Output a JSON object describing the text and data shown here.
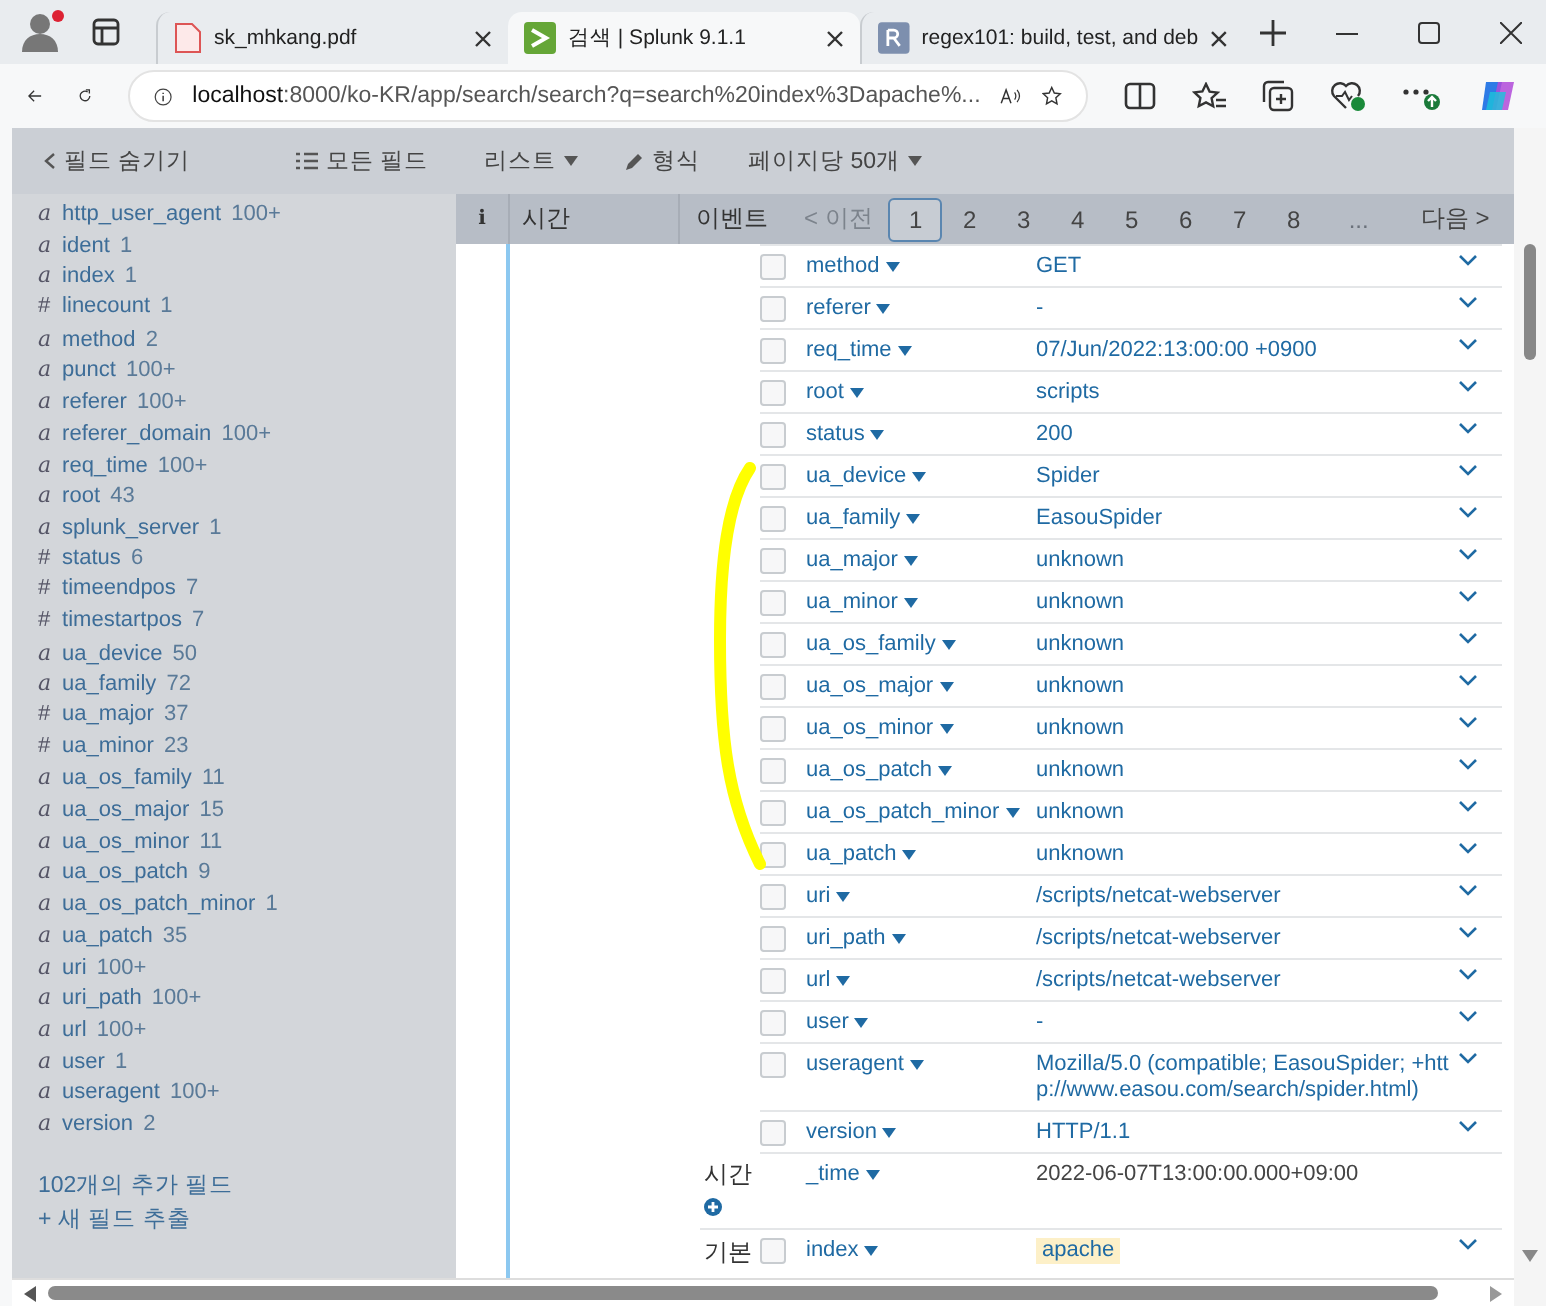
{
  "browser": {
    "tabs": [
      {
        "title": "sk_mhkang.pdf",
        "kind": "pdf",
        "selected": false
      },
      {
        "title": "검색 | Splunk 9.1.1",
        "kind": "splunk",
        "selected": true
      },
      {
        "title": "regex101: build, test, and deb",
        "kind": "regex",
        "selected": false
      }
    ],
    "url_host": "localhost",
    "url_rest": ":8000/ko-KR/app/search/search?q=search%20index%3Dapache%..."
  },
  "toolbar": {
    "hide_fields": "필드 숨기기",
    "all_fields": "모든 필드",
    "list": "리스트",
    "format": "형식",
    "per_page": "페이지당 50개"
  },
  "sidebar": {
    "fields": [
      {
        "icon": "a",
        "name": "http_user_agent",
        "count": "100+"
      },
      {
        "icon": "a",
        "name": "ident",
        "count": "1"
      },
      {
        "icon": "a",
        "name": "index",
        "count": "1"
      },
      {
        "icon": "#",
        "name": "linecount",
        "count": "1"
      },
      {
        "icon": "a",
        "name": "method",
        "count": "2"
      },
      {
        "icon": "a",
        "name": "punct",
        "count": "100+"
      },
      {
        "icon": "a",
        "name": "referer",
        "count": "100+"
      },
      {
        "icon": "a",
        "name": "referer_domain",
        "count": "100+"
      },
      {
        "icon": "a",
        "name": "req_time",
        "count": "100+"
      },
      {
        "icon": "a",
        "name": "root",
        "count": "43"
      },
      {
        "icon": "a",
        "name": "splunk_server",
        "count": "1"
      },
      {
        "icon": "#",
        "name": "status",
        "count": "6"
      },
      {
        "icon": "#",
        "name": "timeendpos",
        "count": "7"
      },
      {
        "icon": "#",
        "name": "timestartpos",
        "count": "7"
      },
      {
        "icon": "a",
        "name": "ua_device",
        "count": "50"
      },
      {
        "icon": "a",
        "name": "ua_family",
        "count": "72"
      },
      {
        "icon": "#",
        "name": "ua_major",
        "count": "37"
      },
      {
        "icon": "#",
        "name": "ua_minor",
        "count": "23"
      },
      {
        "icon": "a",
        "name": "ua_os_family",
        "count": "11"
      },
      {
        "icon": "a",
        "name": "ua_os_major",
        "count": "15"
      },
      {
        "icon": "a",
        "name": "ua_os_minor",
        "count": "11"
      },
      {
        "icon": "a",
        "name": "ua_os_patch",
        "count": "9"
      },
      {
        "icon": "a",
        "name": "ua_os_patch_minor",
        "count": "1"
      },
      {
        "icon": "a",
        "name": "ua_patch",
        "count": "35"
      },
      {
        "icon": "a",
        "name": "uri",
        "count": "100+"
      },
      {
        "icon": "a",
        "name": "uri_path",
        "count": "100+"
      },
      {
        "icon": "a",
        "name": "url",
        "count": "100+"
      },
      {
        "icon": "a",
        "name": "user",
        "count": "1"
      },
      {
        "icon": "a",
        "name": "useragent",
        "count": "100+"
      },
      {
        "icon": "a",
        "name": "version",
        "count": "2"
      }
    ],
    "more_fields": "102개의 추가 필드",
    "extract": "+ 새 필드 추출"
  },
  "table": {
    "columns": [
      "i",
      "시간",
      "이벤트"
    ],
    "pagination": {
      "prev": "< 이전",
      "prev_disabled": true,
      "pages": [
        {
          "label": "1",
          "selected": true
        },
        {
          "label": "2",
          "selected": false
        },
        {
          "label": "3",
          "selected": false
        },
        {
          "label": "4",
          "selected": false
        },
        {
          "label": "5",
          "selected": false
        },
        {
          "label": "6",
          "selected": false
        },
        {
          "label": "7",
          "selected": false
        },
        {
          "label": "8",
          "selected": false
        }
      ],
      "ellipsis": "...",
      "next": "다음 >"
    },
    "fields": [
      {
        "name": "method",
        "value": "GET",
        "checked": false
      },
      {
        "name": "referer",
        "value": "-",
        "checked": false
      },
      {
        "name": "req_time",
        "value": "07/Jun/2022:13:00:00 +0900",
        "checked": false
      },
      {
        "name": "root",
        "value": "scripts",
        "checked": false
      },
      {
        "name": "status",
        "value": "200",
        "checked": false
      },
      {
        "name": "ua_device",
        "value": "Spider",
        "checked": false
      },
      {
        "name": "ua_family",
        "value": "EasouSpider",
        "checked": false
      },
      {
        "name": "ua_major",
        "value": "unknown",
        "checked": false
      },
      {
        "name": "ua_minor",
        "value": "unknown",
        "checked": false
      },
      {
        "name": "ua_os_family",
        "value": "unknown",
        "checked": false
      },
      {
        "name": "ua_os_major",
        "value": "unknown",
        "checked": false
      },
      {
        "name": "ua_os_minor",
        "value": "unknown",
        "checked": false
      },
      {
        "name": "ua_os_patch",
        "value": "unknown",
        "checked": false
      },
      {
        "name": "ua_os_patch_minor",
        "value": "unknown",
        "checked": false
      },
      {
        "name": "ua_patch",
        "value": "unknown",
        "checked": false
      },
      {
        "name": "uri",
        "value": "/scripts/netcat-webserver",
        "checked": false
      },
      {
        "name": "uri_path",
        "value": "/scripts/netcat-webserver",
        "checked": false
      },
      {
        "name": "url",
        "value": "/scripts/netcat-webserver",
        "checked": false
      },
      {
        "name": "user",
        "value": "-",
        "checked": false
      },
      {
        "name": "useragent",
        "value": "Mozilla/5.0 (compatible; EasouSpider; +http://www.easou.com/search/spider.html)",
        "checked": false
      },
      {
        "name": "version",
        "value": "HTTP/1.1",
        "checked": false
      }
    ],
    "time_section": {
      "label": "시간",
      "field": "_time",
      "value": "2022-06-07T13:00:00.000+09:00"
    },
    "default_section": {
      "label": "기본",
      "field": "index",
      "value": "apache",
      "highlighted": true,
      "checked": false
    }
  }
}
